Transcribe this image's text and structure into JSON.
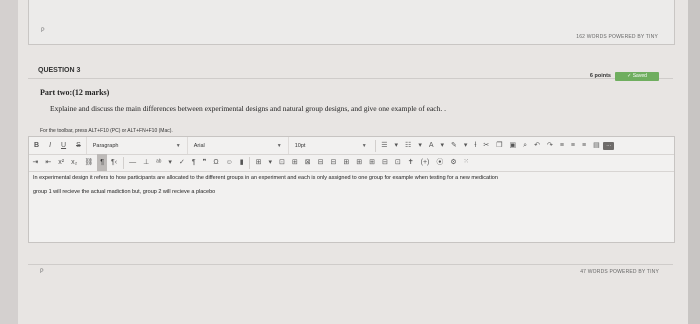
{
  "previous_editor": {
    "path_tag": "P",
    "word_count": "162 WORDS  POWERED BY TINY"
  },
  "question": {
    "title": "QUESTION 3",
    "points": "6 points",
    "saved_label": "Saved",
    "part": "Part two:(12 marks)",
    "prompt": "Explaine and discuss the main differences between experimental designs and natural group designs, and give one example of each. ."
  },
  "editor": {
    "toolbar_hint": "For the toolbar, press ALT+F10 (PC) or ALT+FN+F10 (Mac).",
    "row1": {
      "bold": "B",
      "italic": "I",
      "underline": "U",
      "strike": "S",
      "paragraph": "Paragraph",
      "font": "Arial",
      "size": "10pt",
      "more_label": "···"
    },
    "row2": {
      "superscript": "x²",
      "subscript": "x₂",
      "pilcrow": "¶",
      "omega": "Ω",
      "code": "(+)"
    },
    "content_line1": "In experimental design it refers to how participants are allocated to the different groups in an experiment and each is only assigned to one group for example when testing for a new medication",
    "content_line2": "group 1 will recieve the actual madiction but, group 2 will recieve a placebo",
    "path_tag": "P",
    "word_count": "47 WORDS  POWERED BY TINY"
  },
  "colors": {
    "saved_green": "#6fae5f",
    "page_bg": "#e8e5e3"
  }
}
